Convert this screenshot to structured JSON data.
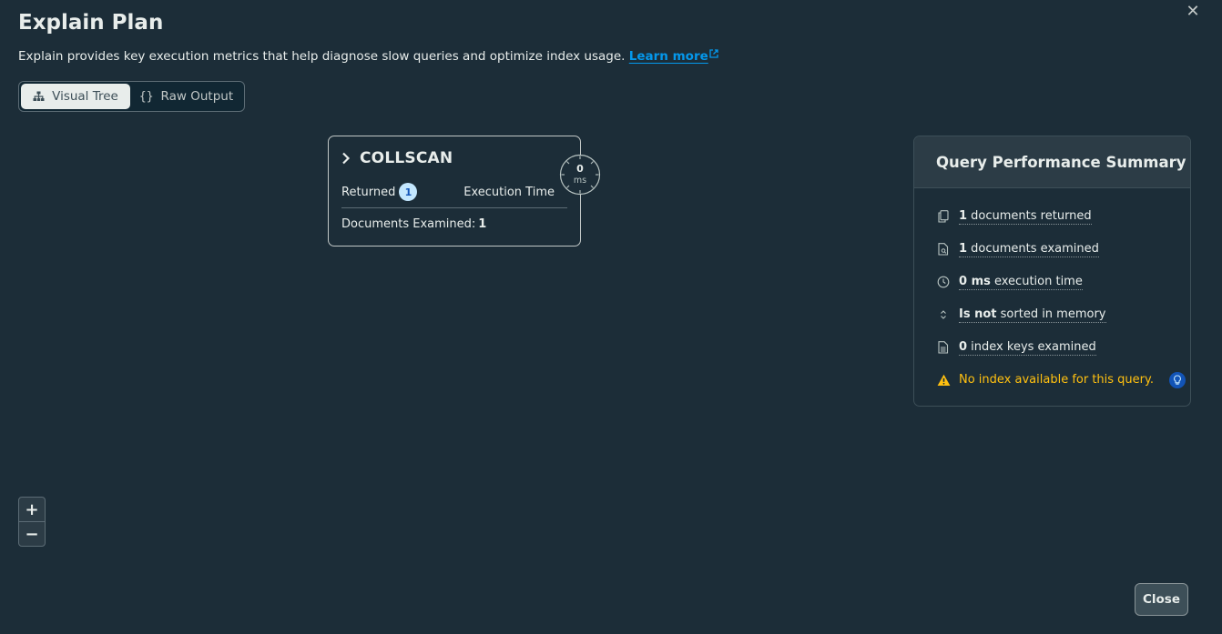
{
  "modal": {
    "title": "Explain Plan",
    "description": "Explain provides key execution metrics that help diagnose slow queries and optimize index usage.",
    "learn_more": "Learn more",
    "close_label": "Close"
  },
  "view_toggle": {
    "visual_tree": "Visual Tree",
    "raw_output": "Raw Output",
    "selected": "Visual Tree"
  },
  "stage": {
    "name": "COLLSCAN",
    "returned_label": "Returned",
    "returned_count": "1",
    "execution_time_label": "Execution Time",
    "execution_time_value": "0",
    "execution_time_unit": "ms",
    "docs_examined_label": "Documents Examined:",
    "docs_examined_value": "1"
  },
  "summary": {
    "title": "Query Performance Summary",
    "items": [
      {
        "bold": "1",
        "rest": " documents returned",
        "icon": "documents-returned-icon"
      },
      {
        "bold": "1",
        "rest": " documents examined",
        "icon": "documents-examined-icon"
      },
      {
        "bold": "0 ms",
        "rest": " execution time",
        "icon": "clock-icon"
      },
      {
        "bold": "Is not",
        "rest": " sorted in memory",
        "icon": "sort-icon"
      },
      {
        "bold": "0",
        "rest": " index keys examined",
        "icon": "index-keys-icon"
      }
    ],
    "warning": "No index available for this query."
  },
  "zoom": {
    "in": "+",
    "out": "−"
  },
  "colors": {
    "background": "#1c2d38",
    "accent_link": "#0498ec",
    "warning": "#ffc010",
    "badge_bg": "#c3e7fe"
  }
}
